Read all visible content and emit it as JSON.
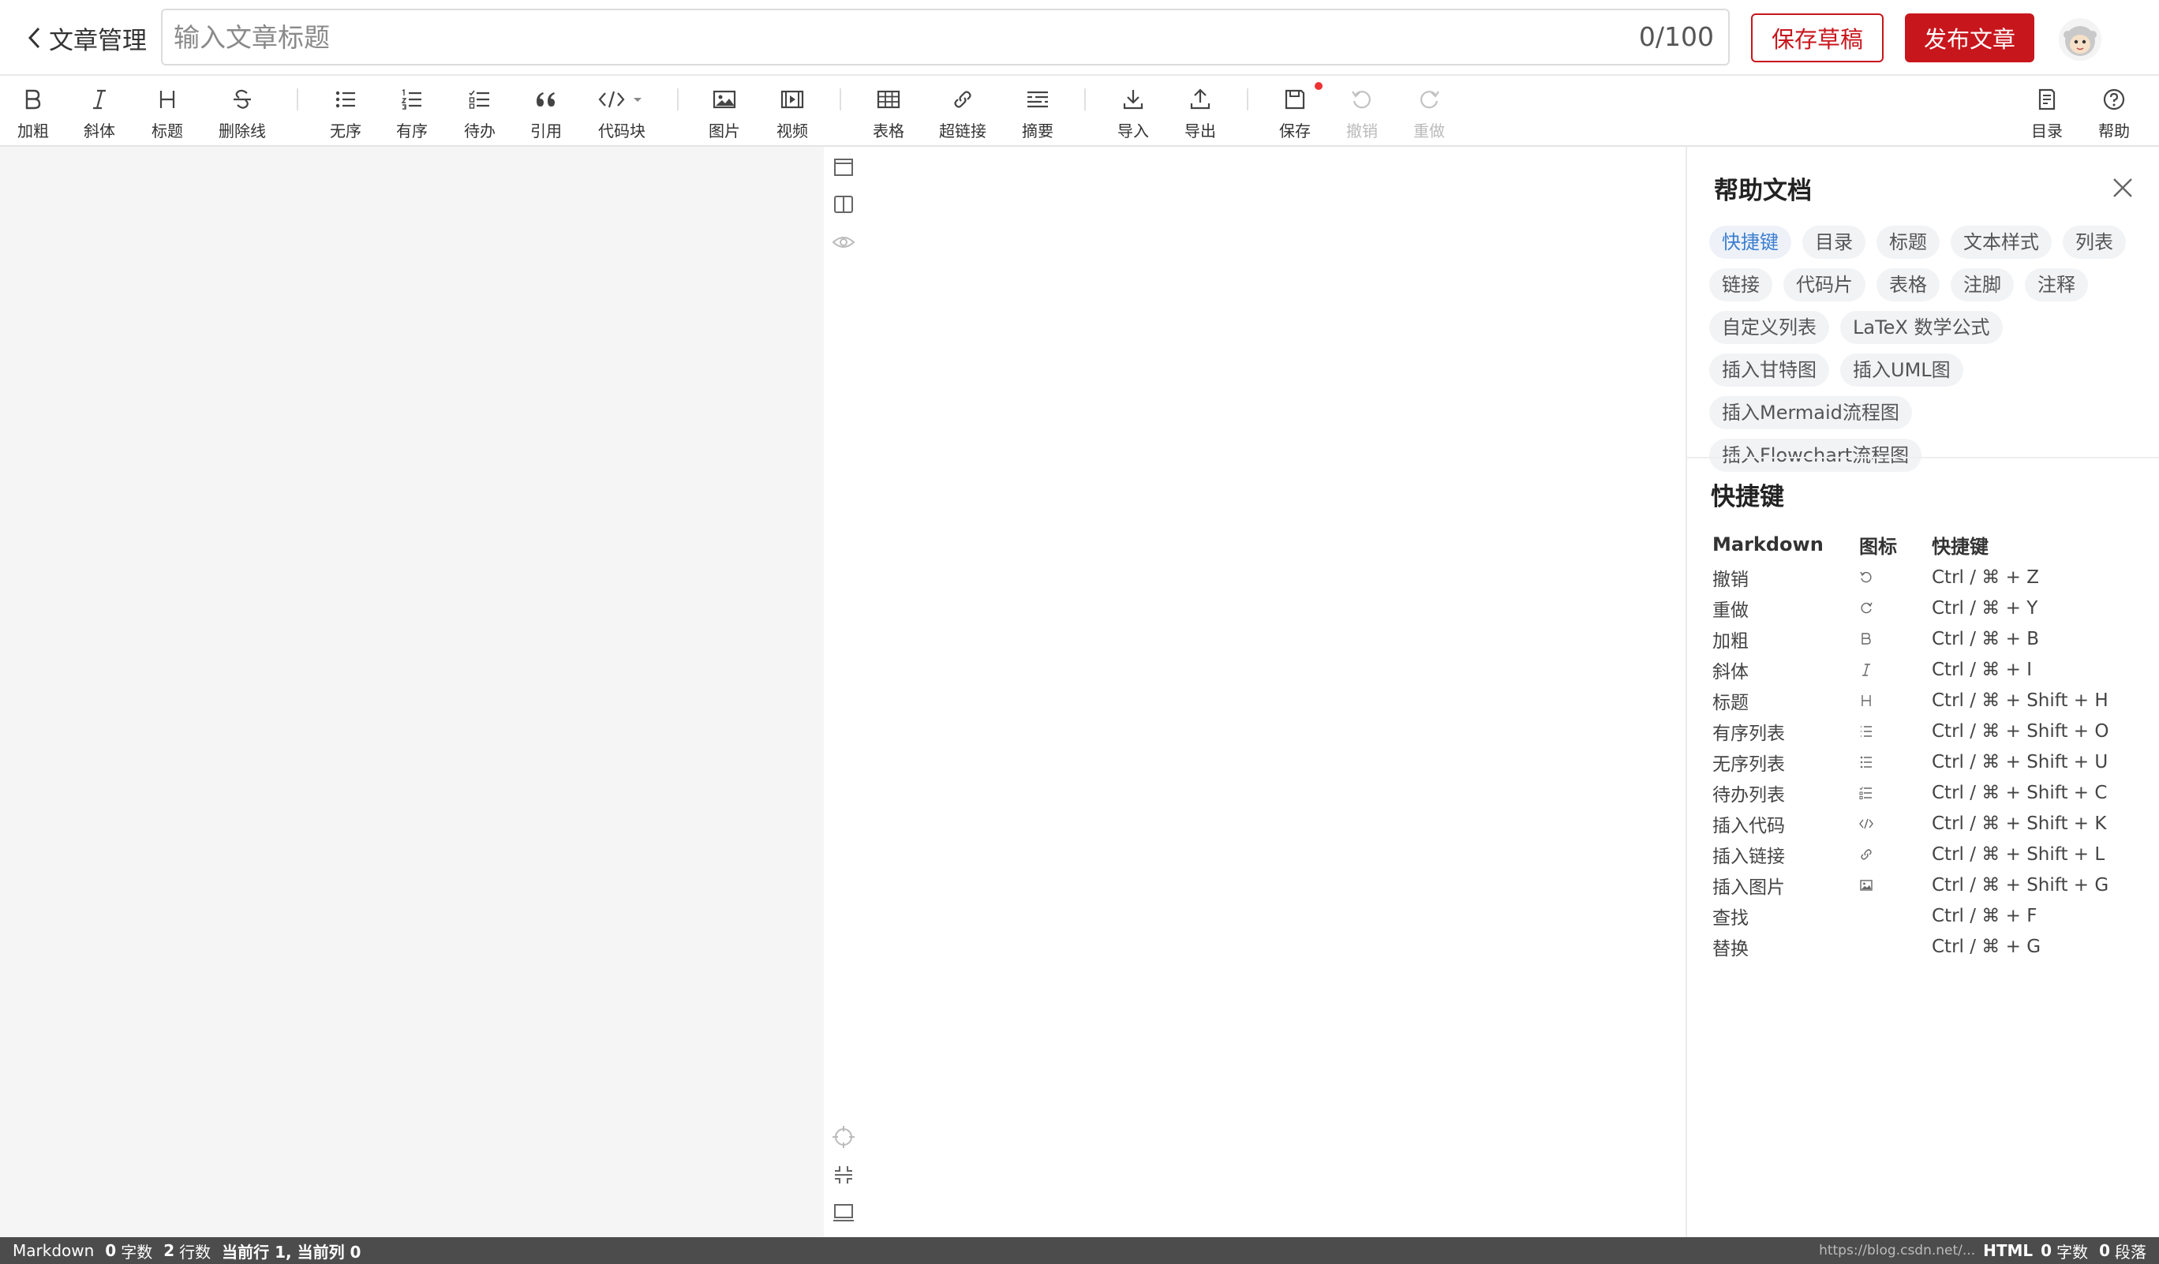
{
  "header": {
    "back_label": "文章管理",
    "title_placeholder": "输入文章标题",
    "counter": "0/100",
    "save_draft": "保存草稿",
    "publish": "发布文章"
  },
  "toolbar": {
    "bold": "加粗",
    "italic": "斜体",
    "heading": "标题",
    "strike": "删除线",
    "ul": "无序",
    "ol": "有序",
    "todo": "待办",
    "quote": "引用",
    "code": "代码块",
    "image": "图片",
    "video": "视频",
    "table": "表格",
    "link": "超链接",
    "summary": "摘要",
    "import": "导入",
    "export": "导出",
    "save": "保存",
    "undo": "撤销",
    "redo": "重做",
    "toc": "目录",
    "help": "帮助"
  },
  "help": {
    "title": "帮助文档",
    "chips": [
      "快捷键",
      "目录",
      "标题",
      "文本样式",
      "列表",
      "链接",
      "代码片",
      "表格",
      "注脚",
      "注释",
      "自定义列表",
      "LaTeX 数学公式",
      "插入甘特图",
      "插入UML图",
      "插入Mermaid流程图",
      "插入Flowchart流程图"
    ],
    "shortcut_title": "快捷键",
    "columns": [
      "Markdown",
      "图标",
      "快捷键"
    ],
    "rows": [
      {
        "name": "撤销",
        "icon": "undo-icon",
        "key": "Ctrl / ⌘ + Z"
      },
      {
        "name": "重做",
        "icon": "redo-icon",
        "key": "Ctrl / ⌘ + Y"
      },
      {
        "name": "加粗",
        "icon": "bold-icon",
        "key": "Ctrl / ⌘ + B"
      },
      {
        "name": "斜体",
        "icon": "italic-icon",
        "key": "Ctrl / ⌘ + I"
      },
      {
        "name": "标题",
        "icon": "heading-icon",
        "key": "Ctrl / ⌘ + Shift + H"
      },
      {
        "name": "有序列表",
        "icon": "ordered-list-icon",
        "key": "Ctrl / ⌘ + Shift + O"
      },
      {
        "name": "无序列表",
        "icon": "unordered-list-icon",
        "key": "Ctrl / ⌘ + Shift + U"
      },
      {
        "name": "待办列表",
        "icon": "todo-list-icon",
        "key": "Ctrl / ⌘ + Shift + C"
      },
      {
        "name": "插入代码",
        "icon": "code-icon",
        "key": "Ctrl / ⌘ + Shift + K"
      },
      {
        "name": "插入链接",
        "icon": "link-icon",
        "key": "Ctrl / ⌘ + Shift + L"
      },
      {
        "name": "插入图片",
        "icon": "image-icon",
        "key": "Ctrl / ⌘ + Shift + G"
      },
      {
        "name": "查找",
        "icon": "",
        "key": "Ctrl / ⌘ + F"
      },
      {
        "name": "替换",
        "icon": "",
        "key": "Ctrl / ⌘ + G"
      }
    ]
  },
  "status": {
    "mode": "Markdown",
    "chars_num": "0",
    "chars_label": "字数",
    "lines_num": "2",
    "lines_label": "行数",
    "position": "当前行 1, 当前列 0",
    "url": "https://blog.csdn.net/...",
    "html_label": "HTML",
    "html_chars_num": "0",
    "html_chars_label": "字数",
    "paras_num": "0",
    "paras_label": "段落"
  },
  "colors": {
    "brand_red": "#c8161d",
    "chip_active": "#3c7ecf",
    "status_bar": "#4c4c4c"
  }
}
